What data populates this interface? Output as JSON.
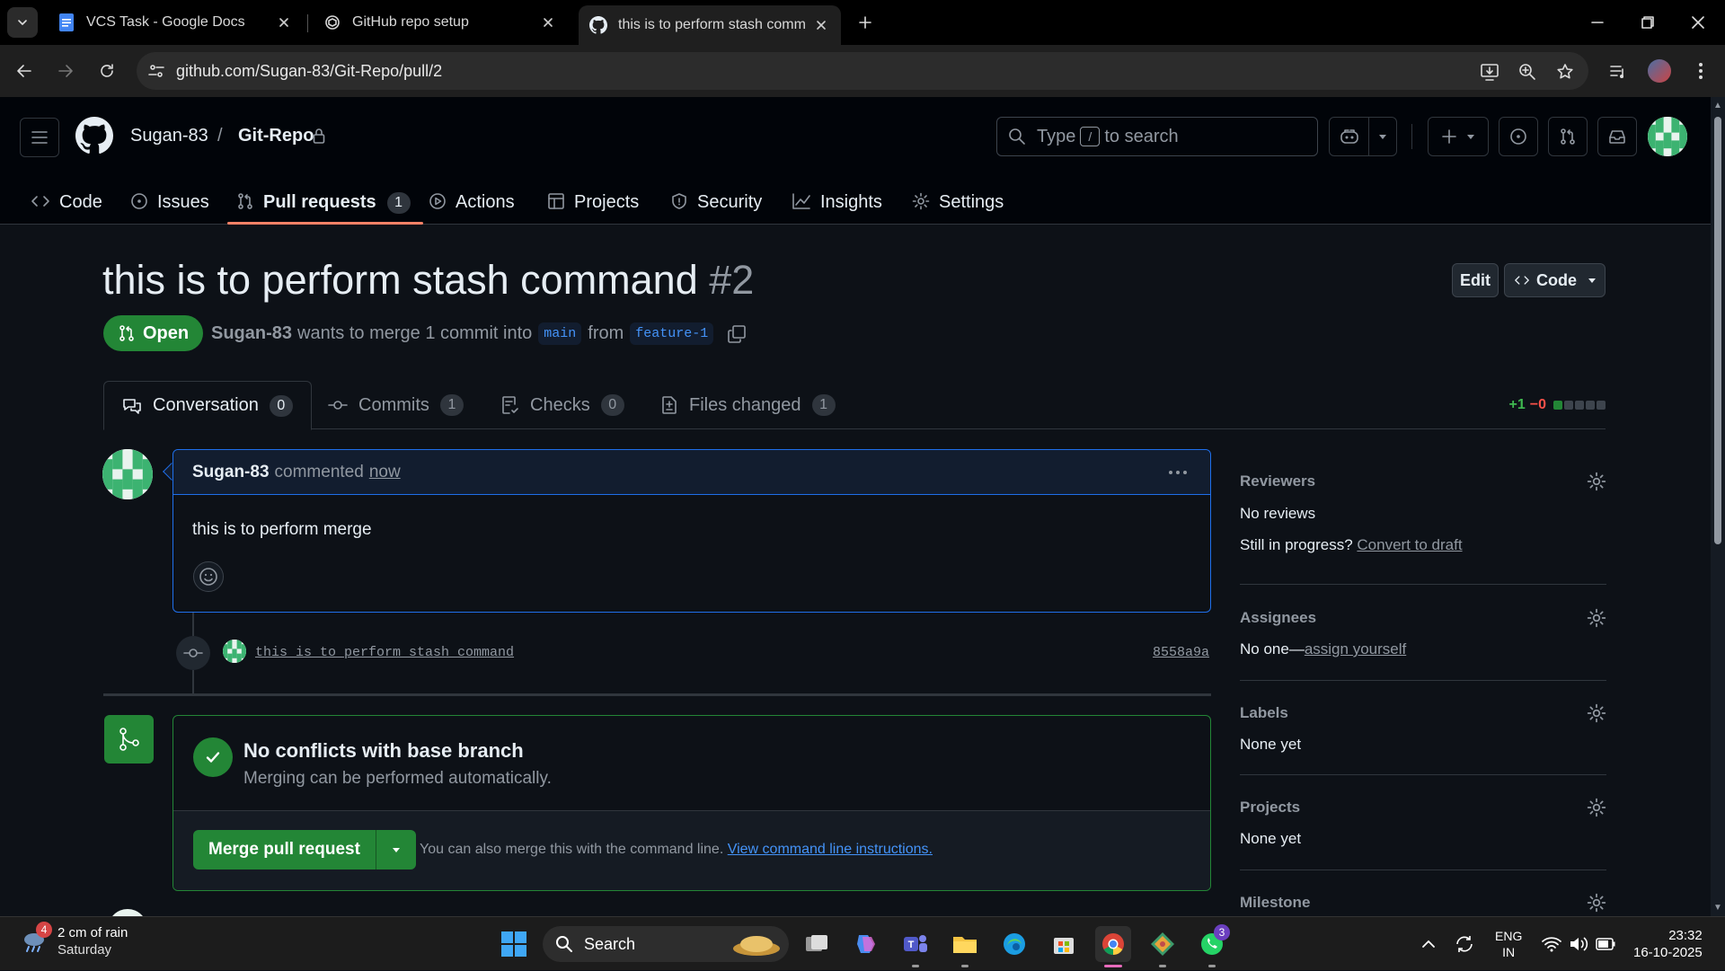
{
  "browser": {
    "tabs": [
      {
        "title": "VCS Task - Google Docs",
        "icon": "google-docs-icon"
      },
      {
        "title": "GitHub repo setup",
        "icon": "chatgpt-icon"
      },
      {
        "title": "this is to perform stash command",
        "icon": "github-icon",
        "active": true
      }
    ],
    "url": "github.com/Sugan-83/Git-Repo/pull/2"
  },
  "header": {
    "owner": "Sugan-83",
    "separator": "/",
    "repo": "Git-Repo",
    "search_pre": "Type",
    "search_key": "/",
    "search_post": "to search"
  },
  "repo_nav": {
    "code": "Code",
    "issues": "Issues",
    "pulls": "Pull requests",
    "pulls_count": "1",
    "actions": "Actions",
    "projects": "Projects",
    "security": "Security",
    "insights": "Insights",
    "settings": "Settings"
  },
  "pr": {
    "title": "this is to perform stash command",
    "number": "#2",
    "edit_label": "Edit",
    "code_label": "Code",
    "state": "Open",
    "author": "Sugan-83",
    "meta_text": "wants to merge 1 commit into",
    "base": "main",
    "from_text": "from",
    "head": "feature-1"
  },
  "pr_tabs": {
    "conversation": "Conversation",
    "conversation_count": "0",
    "commits": "Commits",
    "commits_count": "1",
    "checks": "Checks",
    "checks_count": "0",
    "files": "Files changed",
    "files_count": "1",
    "additions": "+1",
    "deletions": "−0"
  },
  "comment": {
    "author": "Sugan-83",
    "action": "commented",
    "time": "now",
    "body": "this is to perform merge"
  },
  "commit": {
    "message": "this is to perform stash command",
    "sha": "8558a9a"
  },
  "merge": {
    "title": "No conflicts with base branch",
    "subtitle": "Merging can be performed automatically.",
    "button": "Merge pull request",
    "note": "You can also merge this with the command line.",
    "link": "View command line instructions."
  },
  "sidebar": {
    "reviewers_h": "Reviewers",
    "reviewers_v": "No reviews",
    "progress_text": "Still in progress?",
    "convert_link": "Convert to draft",
    "assignees_h": "Assignees",
    "assignees_v": "No one—",
    "assign_link": "assign yourself",
    "labels_h": "Labels",
    "labels_v": "None yet",
    "projects_h": "Projects",
    "projects_v": "None yet",
    "milestone_h": "Milestone"
  },
  "taskbar": {
    "weather_badge": "4",
    "weather_main": "2 cm of rain",
    "weather_sub": "Saturday",
    "search": "Search",
    "whatsapp_badge": "3",
    "lang": "ENG",
    "region": "IN",
    "time": "23:32",
    "date": "16-10-2025"
  },
  "colors": {
    "accent_green": "#238636",
    "link_blue": "#4493f8",
    "tab_underline": "#f78166"
  }
}
